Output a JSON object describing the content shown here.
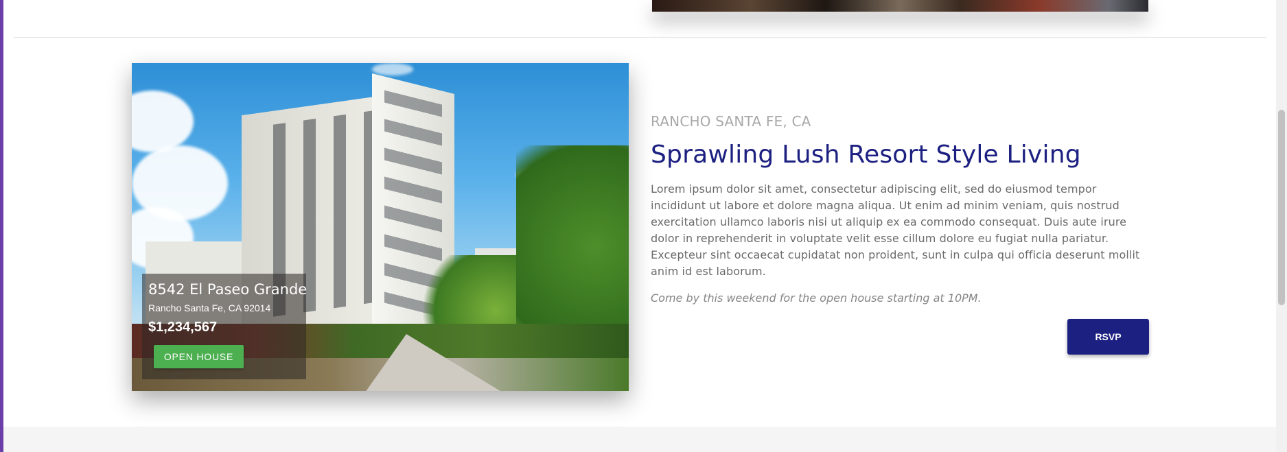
{
  "listing": {
    "location": "RANCHO SANTA FE, CA",
    "headline": "Sprawling Lush Resort Style Living",
    "description": "Lorem ipsum dolor sit amet, consectetur adipiscing elit, sed do eiusmod tempor incididunt ut labore et dolore magna aliqua. Ut enim ad minim veniam, quis nostrud exercitation ullamco laboris nisi ut aliquip ex ea commodo consequat. Duis aute irure dolor in reprehenderit in voluptate velit esse cillum dolore eu fugiat nulla pariatur. Excepteur sint occaecat cupidatat non proident, sunt in culpa qui officia deserunt mollit anim id est laborum.",
    "invite": "Come by this weekend for the open house starting at 10PM.",
    "rsvp_label": "RSVP"
  },
  "photo_overlay": {
    "street": "8542 El Paseo Grande",
    "city_state_zip": "Rancho Santa Fe, CA 92014",
    "price": "$1,234,567",
    "open_house_label": "OPEN HOUSE"
  },
  "colors": {
    "accent_navy": "#1c2080",
    "open_house_green": "#4caf50",
    "left_accent_purple": "#6b3fa8"
  }
}
